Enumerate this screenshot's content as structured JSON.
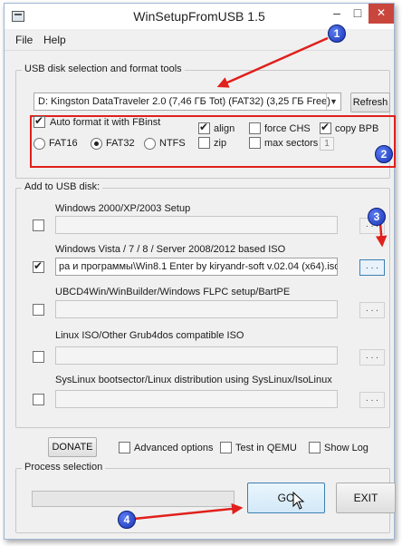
{
  "window": {
    "title": "WinSetupFromUSB 1.5",
    "controls": {
      "minimize": "–",
      "maximize": "□",
      "close": "✕"
    }
  },
  "menu": {
    "file": "File",
    "help": "Help"
  },
  "usb_group": {
    "label": "USB disk selection and format tools",
    "disk_value": "D: Kingston DataTraveler 2.0 (7,46 ГБ Tot) (FAT32) (3,25 ГБ Free)",
    "refresh_label": "Refresh",
    "auto_format": {
      "label": "Auto format it with FBinst",
      "checked": true
    },
    "filesystems": [
      {
        "label": "FAT16",
        "checked": false
      },
      {
        "label": "FAT32",
        "checked": true
      },
      {
        "label": "NTFS",
        "checked": false
      }
    ],
    "options": {
      "align": {
        "label": "align",
        "checked": true
      },
      "zip": {
        "label": "zip",
        "checked": false
      },
      "force_chs": {
        "label": "force CHS",
        "checked": false
      },
      "max_sectors": {
        "label": "max sectors",
        "checked": false
      },
      "copy_bpb": {
        "label": "copy BPB",
        "checked": true
      },
      "max_sectors_value": "1"
    }
  },
  "add_group": {
    "label": "Add to USB disk:",
    "browse_label": ". . .",
    "sources": [
      {
        "label": "Windows 2000/XP/2003 Setup",
        "checked": false,
        "path": ""
      },
      {
        "label": "Windows Vista / 7 / 8 / Server 2008/2012 based ISO",
        "checked": true,
        "path": "ра и программы\\Win8.1 Enter by kiryandr-soft v.02.04 (x64).iso"
      },
      {
        "label": "UBCD4Win/WinBuilder/Windows FLPC setup/BartPE",
        "checked": false,
        "path": ""
      },
      {
        "label": "Linux ISO/Other Grub4dos compatible ISO",
        "checked": false,
        "path": ""
      },
      {
        "label": "SysLinux bootsector/Linux distribution using SysLinux/IsoLinux",
        "checked": false,
        "path": ""
      }
    ]
  },
  "bottom": {
    "donate_label": "DONATE",
    "advanced": {
      "label": "Advanced options",
      "checked": false
    },
    "test_qemu": {
      "label": "Test in QEMU",
      "checked": false
    },
    "show_log": {
      "label": "Show Log",
      "checked": false
    },
    "process_label": "Process selection",
    "progress": 0,
    "go_label": "GO",
    "exit_label": "EXIT"
  },
  "annotations": {
    "markers": [
      "1",
      "2",
      "3",
      "4"
    ],
    "arrow_color": "#e0201c",
    "marker_color": "#1833b4"
  }
}
